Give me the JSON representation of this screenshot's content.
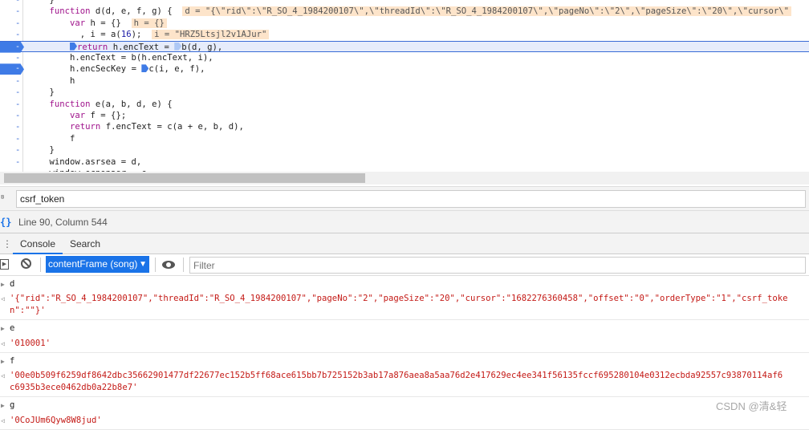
{
  "code": {
    "lines": [
      {
        "text": "    }"
      },
      {
        "pre": "    ",
        "kw": "function",
        "rest": " d(d, e, f, g) {",
        "ann": "d = \"{\\\"rid\\\":\\\"R_SO_4_1984200107\\\",\\\"threadId\\\":\\\"R_SO_4_1984200107\\\",\\\"pageNo\\\":\\\"2\\\",\\\"pageSize\\\":\\\"20\\\",\\\"cursor\\\""
      },
      {
        "pre": "        ",
        "kw": "var",
        "rest": " h = {}",
        "ann": "h = {}"
      },
      {
        "pre": "          , i = a(",
        "num": "16",
        "rest2": ");",
        "ann": "i = \"HRZ5Ltsjl2v1AJur\""
      },
      {
        "bp": true,
        "hl": true,
        "pre": "        ",
        "kw": "return",
        "rest": " h.encText = ",
        "rest2": "b(d, g),"
      },
      {
        "text": "        h.encText = b(h.encText, i),"
      },
      {
        "bp": true,
        "pre": "        h.encSecKey ",
        "rest": "= ",
        "rest2": "c(i, e, f),"
      },
      {
        "text": "        h"
      },
      {
        "text": "    }"
      },
      {
        "pre": "    ",
        "kw": "function",
        "rest": " e(a, b, d, e) {"
      },
      {
        "pre": "        ",
        "kw": "var",
        "rest": " f = {};"
      },
      {
        "pre": "        ",
        "kw": "return",
        "rest": " f.encText = c(a + e, b, d),"
      },
      {
        "text": "        f"
      },
      {
        "text": "    }"
      },
      {
        "text": "    window.asrsea = d,"
      },
      {
        "text": "    window.ecnonasr = e,"
      }
    ]
  },
  "search": {
    "value": "csrf_token"
  },
  "status": {
    "position": "Line 90, Column 544"
  },
  "tabs": [
    {
      "label": "Console",
      "active": true
    },
    {
      "label": "Search",
      "active": false
    }
  ],
  "toolbar": {
    "context": "contentFrame (song)",
    "filter_placeholder": "Filter"
  },
  "console": [
    {
      "input": "d",
      "output": "'{\"rid\":\"R_SO_4_1984200107\",\"threadId\":\"R_SO_4_1984200107\",\"pageNo\":\"2\",\"pageSize\":\"20\",\"cursor\":\"1682276360458\",\"offset\":\"0\",\"orderType\":\"1\",\"csrf_token\":\"\"}'"
    },
    {
      "input": "e",
      "output": "'010001'"
    },
    {
      "input": "f",
      "output": "'00e0b509f6259df8642dbc35662901477df22677ec152b5ff68ace615bb7b725152b3ab17a876aea8a5aa76d2e417629ec4ee341f56135fccf695280104e0312ecbda92557c93870114af6",
      "output2": "c6935b3ece0462db0a22b8e7'"
    },
    {
      "input": "g",
      "output": "'0CoJUm6Qyw8W8jud'"
    }
  ],
  "watermark": "CSDN @清&轻",
  "colors": {
    "accent": "#1a73e8",
    "breakpoint": "#3f7be6",
    "string": "#c41a16",
    "keyword": "#a0148c",
    "annotation_bg": "#fde4ca"
  }
}
